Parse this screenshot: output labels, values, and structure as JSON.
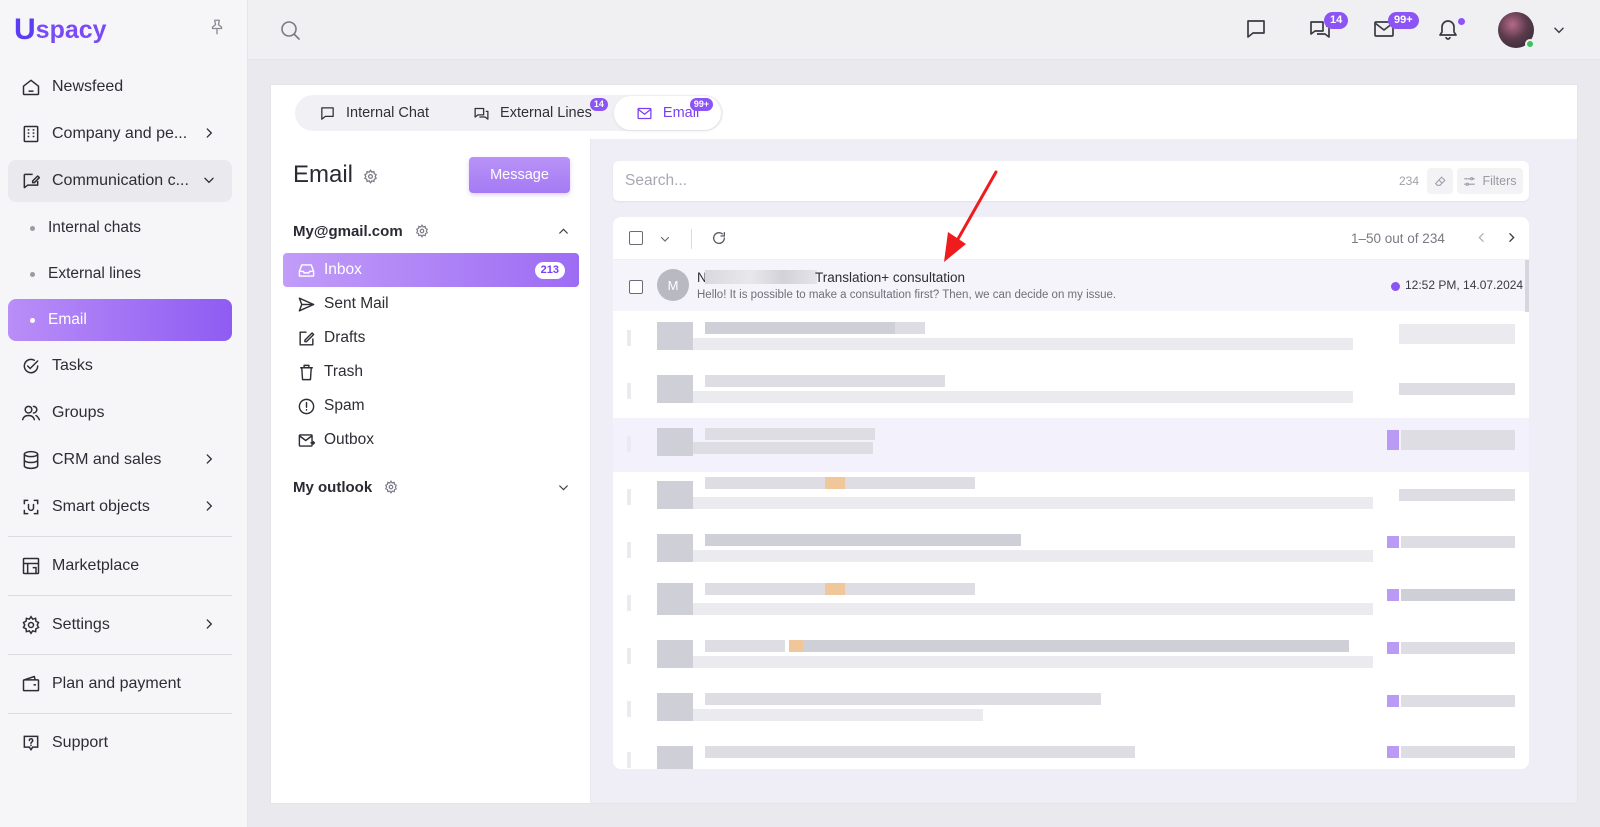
{
  "app": {
    "logo_mark": "U",
    "logo_text": "spacy"
  },
  "sidebar": {
    "items": [
      {
        "label": "Newsfeed",
        "icon": "home-icon"
      },
      {
        "label": "Company and pe...",
        "icon": "building-icon",
        "has_children": true
      },
      {
        "label": "Communication c...",
        "icon": "chat-edit-icon",
        "expanded": true
      },
      {
        "label": "Internal chats"
      },
      {
        "label": "External lines"
      },
      {
        "label": "Email",
        "active": true
      },
      {
        "label": "Tasks",
        "icon": "check-circle-icon"
      },
      {
        "label": "Groups",
        "icon": "users-icon"
      },
      {
        "label": "CRM and sales",
        "icon": "database-icon",
        "has_children": true
      },
      {
        "label": "Smart objects",
        "icon": "scan-icon",
        "has_children": true
      },
      {
        "label": "Marketplace",
        "icon": "store-icon"
      },
      {
        "label": "Settings",
        "icon": "gear-icon",
        "has_children": true
      },
      {
        "label": "Plan and payment",
        "icon": "wallet-icon"
      },
      {
        "label": "Support",
        "icon": "help-icon"
      }
    ]
  },
  "topbar": {
    "chat_badge": "14",
    "mail_badge": "99+"
  },
  "tabs": [
    {
      "label": "Internal Chat",
      "icon": "chat-icon"
    },
    {
      "label": "External Lines",
      "icon": "chats-icon",
      "badge": "14"
    },
    {
      "label": "Email",
      "icon": "mail-icon",
      "badge": "99+",
      "active": true
    }
  ],
  "email_panel": {
    "title": "Email",
    "message_button": "Message",
    "accounts": [
      {
        "name": "My@gmail.com",
        "expanded": true
      },
      {
        "name": "My outlook",
        "expanded": false
      }
    ],
    "folders": [
      {
        "label": "Inbox",
        "icon": "inbox-icon",
        "count": "213",
        "active": true
      },
      {
        "label": "Sent Mail",
        "icon": "send-icon"
      },
      {
        "label": "Drafts",
        "icon": "edit-icon"
      },
      {
        "label": "Trash",
        "icon": "trash-icon"
      },
      {
        "label": "Spam",
        "icon": "alert-icon"
      },
      {
        "label": "Outbox",
        "icon": "outbox-icon"
      }
    ]
  },
  "search": {
    "placeholder": "Search...",
    "count": "234",
    "filters_label": "Filters"
  },
  "list": {
    "range": "1–50 out of 234",
    "first_message": {
      "avatar_letter": "M",
      "sender_initial": "N",
      "subject": "Translation+ consultation",
      "preview": "Hello! It is possible to make a consultation first? Then, we can decide on my issue.",
      "time": "12:52 PM, 14.07.2024"
    }
  },
  "colors": {
    "accent": "#8d54f5",
    "accent_light": "#b98ef7",
    "annotation_arrow": "#ee1c1c"
  }
}
